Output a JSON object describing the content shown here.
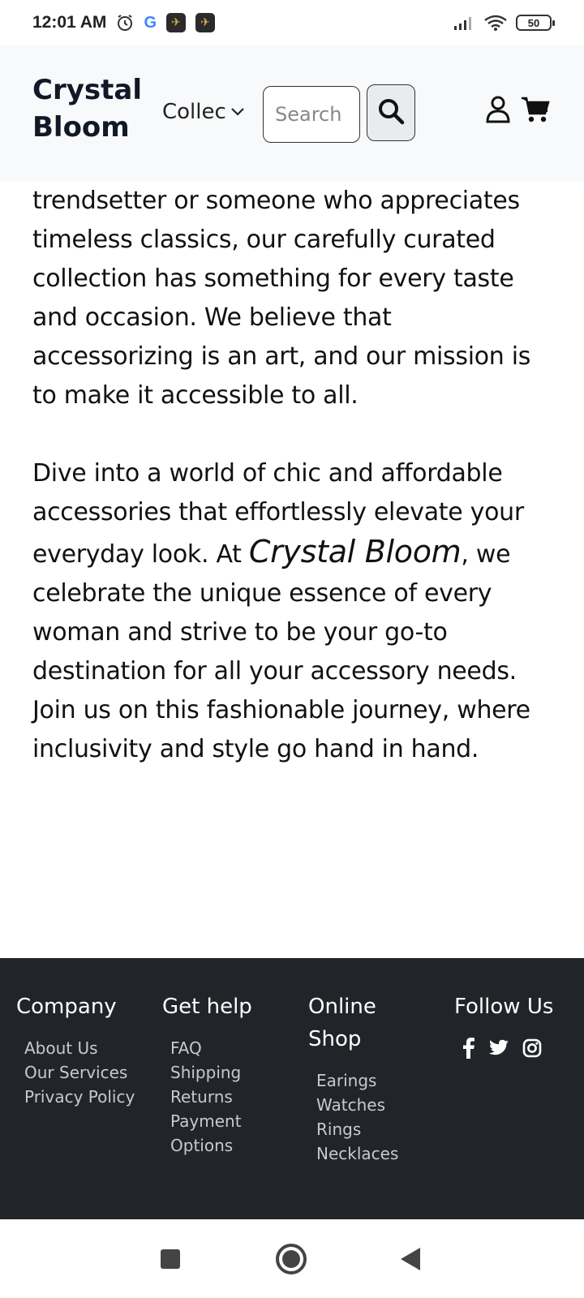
{
  "status_bar": {
    "time": "12:01 AM",
    "battery": "50",
    "icons": [
      "alarm-icon",
      "google-icon",
      "app-icon",
      "app-icon",
      "signal-icon",
      "wifi-icon",
      "battery-icon"
    ]
  },
  "navbar": {
    "brand": "Crystal Bloom",
    "collections_label": "Collections",
    "search_placeholder": "Search",
    "icons": [
      "search-icon",
      "user-icon",
      "cart-icon",
      "chevron-down-icon"
    ]
  },
  "content": {
    "paragraph1": "trendsetter or someone who appreciates timeless classics, our carefully curated collection has something for every taste and occasion. We believe that accessorizing is an art, and our mission is to make it accessible to all.",
    "paragraph2_before": "Dive into a world of chic and affordable accessories that effortlessly elevate your everyday look. At ",
    "paragraph2_brand": "Crystal Bloom",
    "paragraph2_after": ", we celebrate the unique essence of every woman and strive to be your go-to destination for all your accessory needs. Join us on this fashionable journey, where inclusivity and style go hand in hand."
  },
  "footer": {
    "company": {
      "heading": "Company",
      "links": [
        "About Us",
        "Our Services",
        "Privacy Policy"
      ]
    },
    "help": {
      "heading": "Get help",
      "links": [
        "FAQ",
        "Shipping",
        "Returns",
        "Payment Options"
      ]
    },
    "shop": {
      "heading": "Online Shop",
      "links": [
        "Earings",
        "Watches",
        "Rings",
        "Necklaces"
      ]
    },
    "follow": {
      "heading": "Follow Us",
      "icons": [
        "facebook-icon",
        "twitter-icon",
        "instagram-icon"
      ]
    }
  },
  "colors": {
    "navbar_bg": "#f8f9fa",
    "footer_bg": "#212529",
    "brand_text": "#111827",
    "footer_link": "#c7c9cc"
  }
}
